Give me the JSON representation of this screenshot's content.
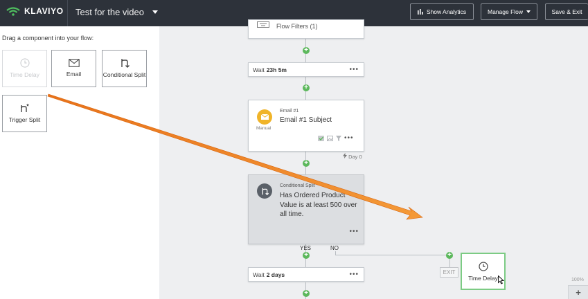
{
  "app": {
    "brand": "KLAVIYO",
    "flow_title": "Test for the video"
  },
  "toolbar": {
    "analytics_label": "Show Analytics",
    "manage_label": "Manage Flow",
    "save_label": "Save & Exit"
  },
  "panel": {
    "title": "Drag a component into your flow:",
    "components": [
      {
        "label": "Time Delay",
        "icon": "clock-icon",
        "enabled": false
      },
      {
        "label": "Email",
        "icon": "envelope-icon",
        "enabled": true
      },
      {
        "label": "Conditional Split",
        "icon": "split-icon",
        "enabled": true
      },
      {
        "label": "Trigger Split",
        "icon": "trigger-split-icon",
        "enabled": true
      }
    ]
  },
  "flow": {
    "filters_label": "Flow Filters (1)",
    "wait1": {
      "prefix": "Wait",
      "value": "23h 5m"
    },
    "email": {
      "small_label": "Email #1",
      "subject": "Email #1 Subject",
      "badge_label": "Manual",
      "day_label": "Day 0"
    },
    "conditional": {
      "small_label": "Conditional Split",
      "text": "Has Ordered Product Value is at least 500 over all time."
    },
    "yes_label": "YES",
    "no_label": "NO",
    "wait2": {
      "prefix": "Wait",
      "value": "2 days"
    },
    "exit_label": "EXIT",
    "drag_label": "Time Delay"
  },
  "zoom": {
    "label": "100%",
    "button": "+"
  },
  "colors": {
    "topbar": "#2d323a",
    "accent_green": "#5cb85c",
    "email_badge": "#f0b429",
    "annotation_arrow": "#f07f1c"
  }
}
